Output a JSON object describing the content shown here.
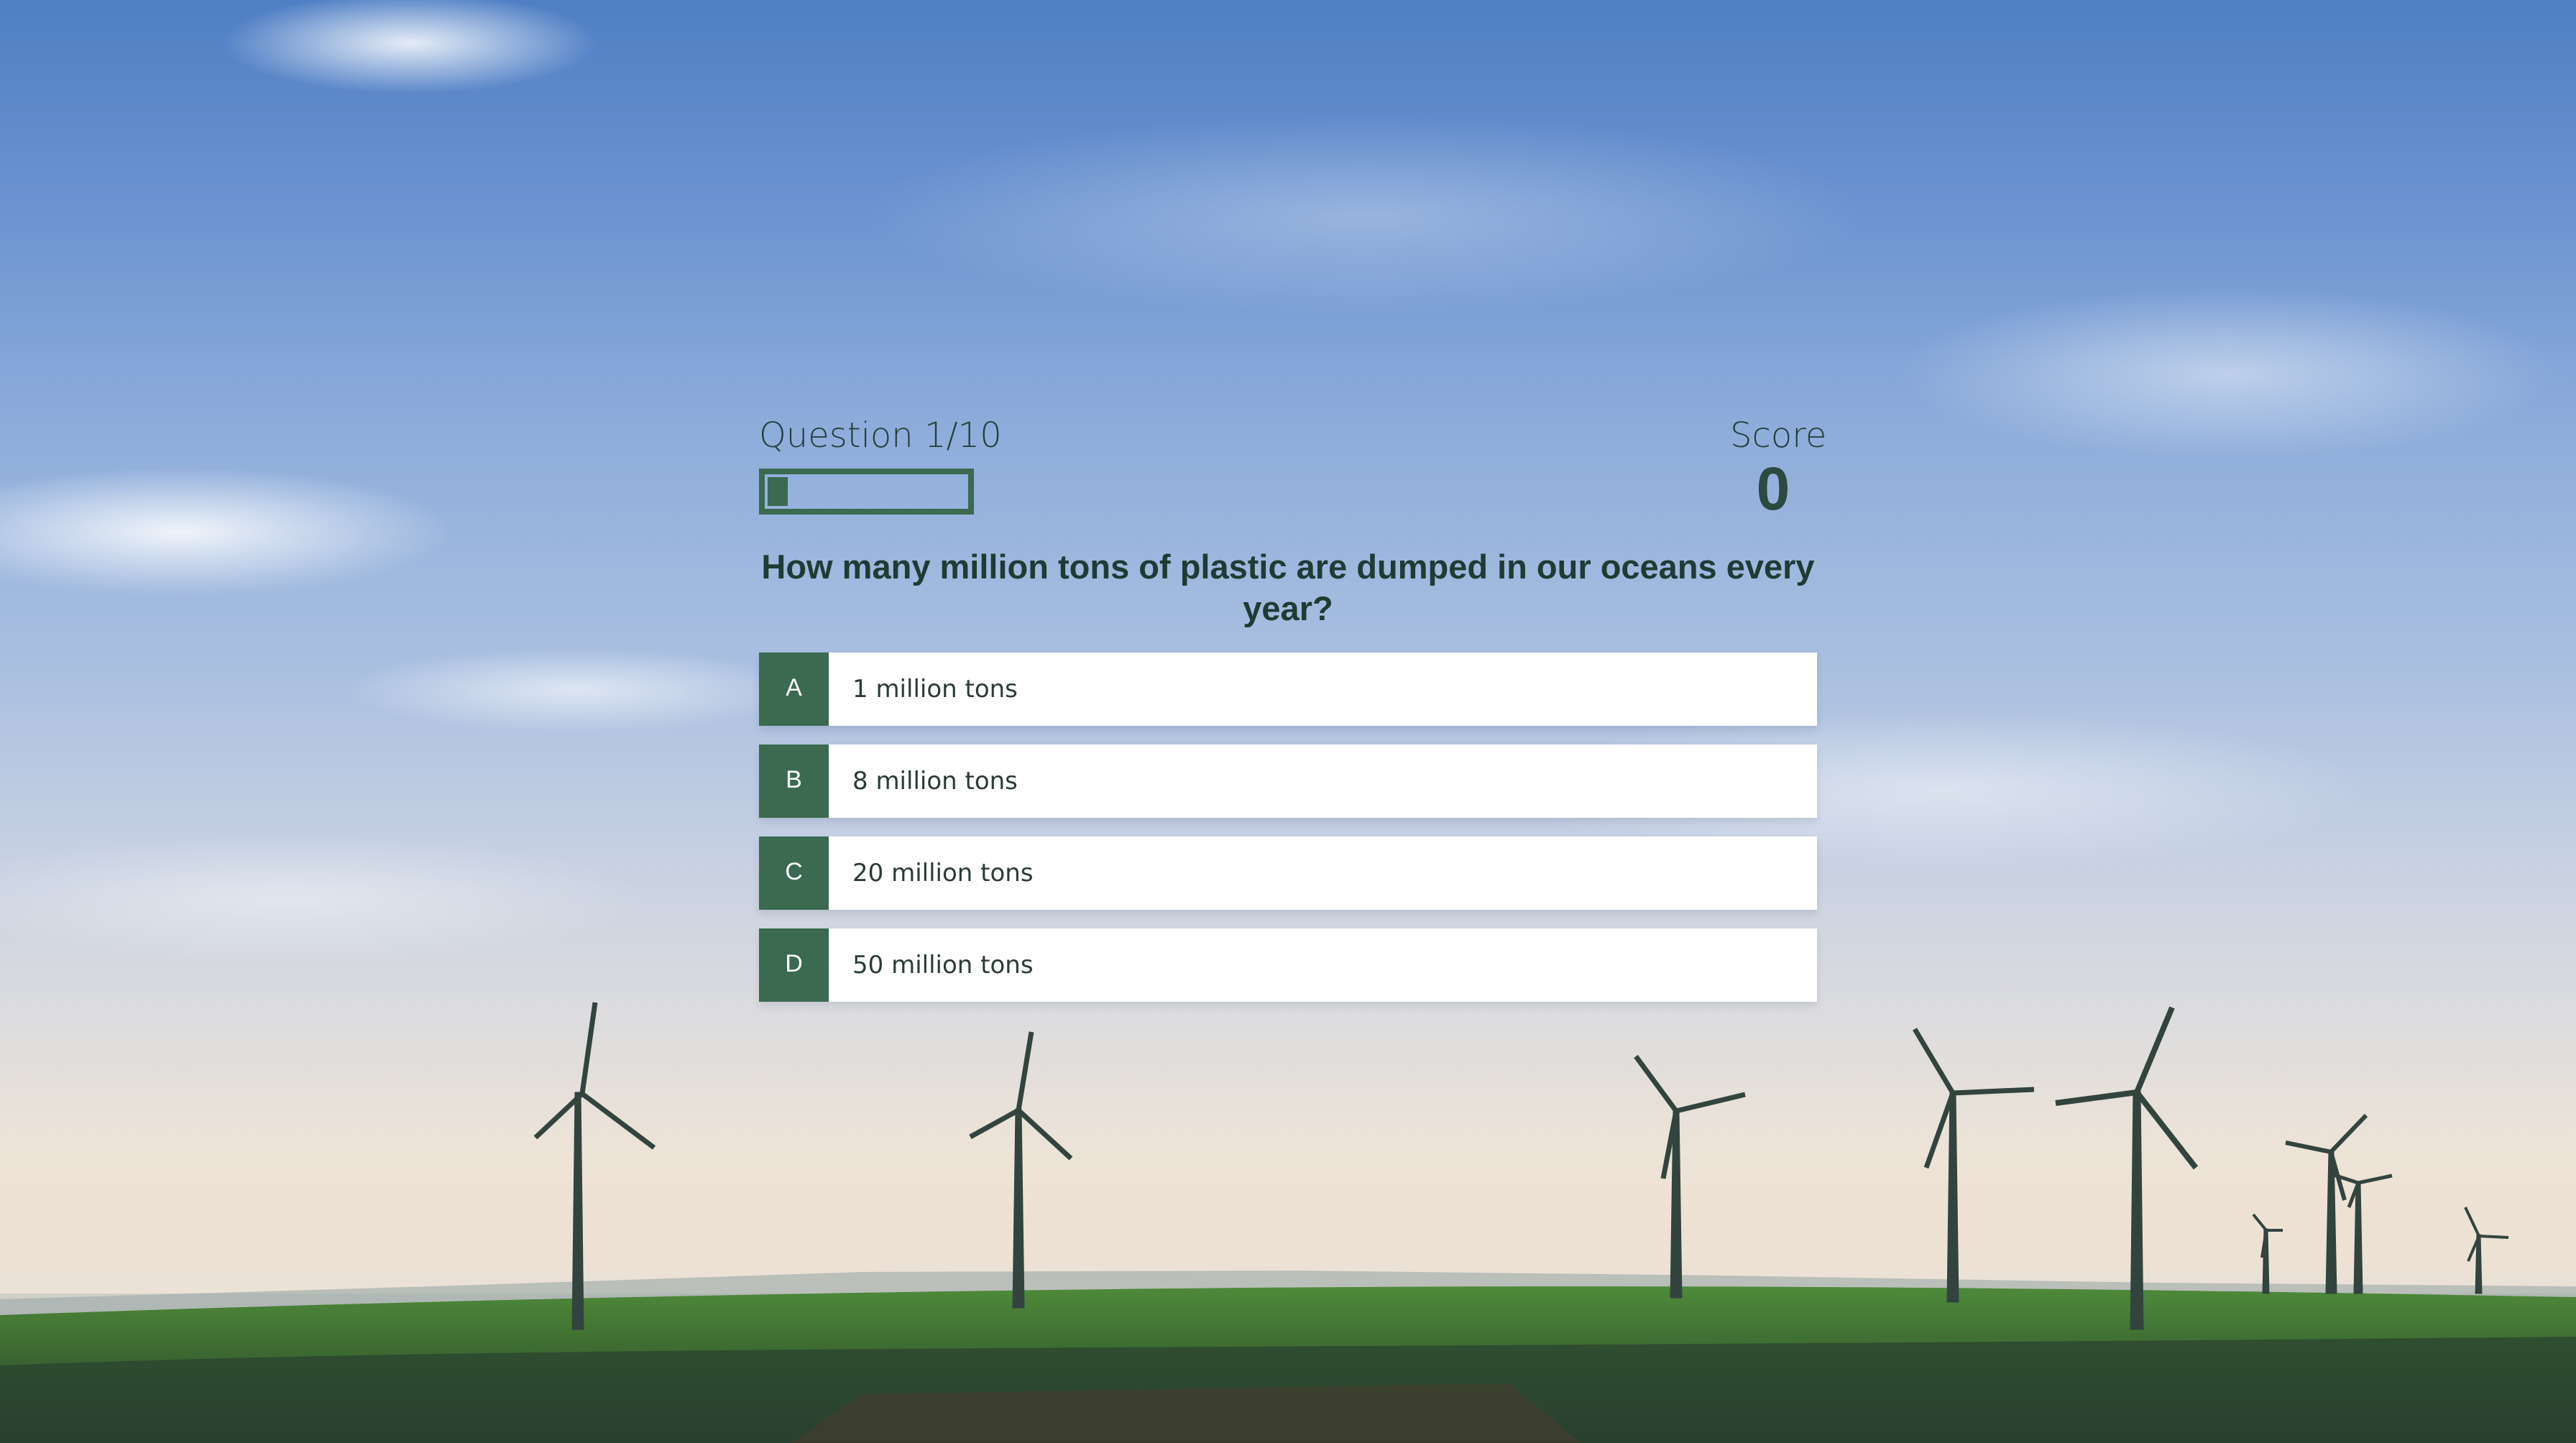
{
  "quiz": {
    "question_label": "Question 1/10",
    "progress": 0.1,
    "score_label": "Score",
    "score_value": "0",
    "question": "How many million tons of plastic are dumped in our oceans every year?",
    "options": [
      {
        "letter": "A",
        "text": "1 million tons"
      },
      {
        "letter": "B",
        "text": "8 million tons"
      },
      {
        "letter": "C",
        "text": "20 million tons"
      },
      {
        "letter": "D",
        "text": "50 million tons"
      }
    ]
  },
  "colors": {
    "accent": "#3b6a50",
    "heading": "#25413a",
    "option_bg": "#ffffff"
  },
  "background": {
    "scene": "wind-turbines-over-green-field-under-blue-sky"
  }
}
